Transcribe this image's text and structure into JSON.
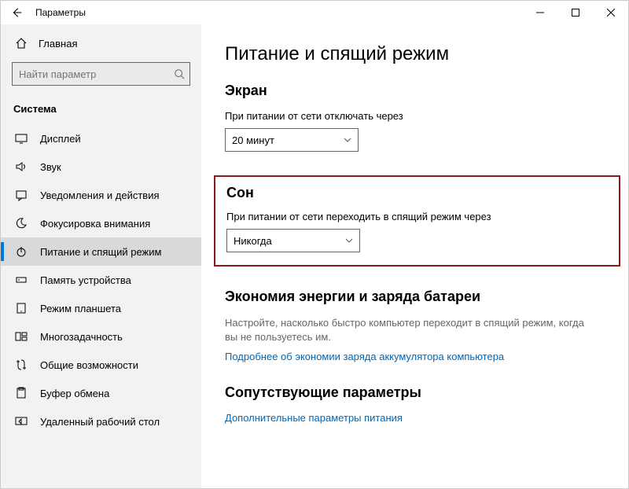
{
  "window": {
    "title": "Параметры"
  },
  "sidebar": {
    "home_label": "Главная",
    "search_placeholder": "Найти параметр",
    "section_label": "Система",
    "items": [
      {
        "label": "Дисплей"
      },
      {
        "label": "Звук"
      },
      {
        "label": "Уведомления и действия"
      },
      {
        "label": "Фокусировка внимания"
      },
      {
        "label": "Питание и спящий режим"
      },
      {
        "label": "Память устройства"
      },
      {
        "label": "Режим планшета"
      },
      {
        "label": "Многозадачность"
      },
      {
        "label": "Общие возможности"
      },
      {
        "label": "Буфер обмена"
      },
      {
        "label": "Удаленный рабочий стол"
      }
    ]
  },
  "main": {
    "page_title": "Питание и спящий режим",
    "screen_section": "Экран",
    "screen_off_label": "При питании от сети отключать через",
    "screen_off_value": "20 минут",
    "sleep_section": "Сон",
    "sleep_label": "При питании от сети переходить в спящий режим через",
    "sleep_value": "Никогда",
    "battery_section": "Экономия энергии и заряда батареи",
    "battery_desc": "Настройте, насколько быстро компьютер переходит в спящий режим, когда вы не пользуетесь им.",
    "battery_link": "Подробнее об экономии заряда аккумулятора компьютера",
    "related_section": "Сопутствующие параметры",
    "related_link": "Дополнительные параметры питания"
  }
}
